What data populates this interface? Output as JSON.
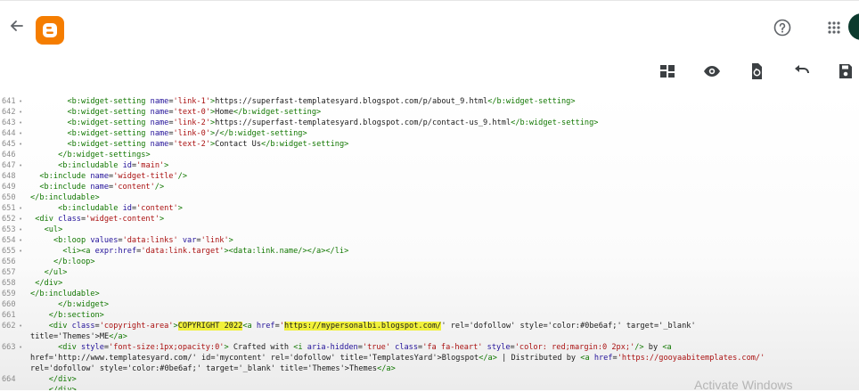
{
  "app": {
    "name": "Blogger"
  },
  "toolbar": {
    "icons": [
      "layout-icon",
      "preview-icon",
      "restore-icon",
      "undo-icon",
      "save-icon"
    ]
  },
  "editor": {
    "lines": [
      {
        "num": "641",
        "fold": "•",
        "text": "        <b:widget-setting name='link-1'>https://superfast-templatesyard.blogspot.com/p/about_9.html</b:widget-setting>"
      },
      {
        "num": "642",
        "fold": "•",
        "text": "        <b:widget-setting name='text-0'>Home</b:widget-setting>"
      },
      {
        "num": "643",
        "fold": "•",
        "text": "        <b:widget-setting name='link-2'>https://superfast-templatesyard.blogspot.com/p/contact-us_9.html</b:widget-setting>"
      },
      {
        "num": "644",
        "fold": "•",
        "text": "        <b:widget-setting name='link-0'>/</b:widget-setting>"
      },
      {
        "num": "645",
        "fold": "•",
        "text": "        <b:widget-setting name='text-2'>Contact Us</b:widget-setting>"
      },
      {
        "num": "646",
        "fold": "",
        "text": "      </b:widget-settings>"
      },
      {
        "num": "647",
        "fold": "•",
        "text": "      <b:includable id='main'>"
      },
      {
        "num": "648",
        "fold": "",
        "text": "  <b:include name='widget-title'/>"
      },
      {
        "num": "649",
        "fold": "",
        "text": "  <b:include name='content'/>"
      },
      {
        "num": "650",
        "fold": "",
        "text": "</b:includable>"
      },
      {
        "num": "651",
        "fold": "•",
        "text": "      <b:includable id='content'>"
      },
      {
        "num": "652",
        "fold": "•",
        "text": " <div class='widget-content'>"
      },
      {
        "num": "653",
        "fold": "•",
        "text": "   <ul>"
      },
      {
        "num": "654",
        "fold": "•",
        "text": "     <b:loop values='data:links' var='link'>"
      },
      {
        "num": "655",
        "fold": "•",
        "text": "       <li><a expr:href='data:link.target'><data:link.name/></a></li>"
      },
      {
        "num": "656",
        "fold": "",
        "text": "     </b:loop>"
      },
      {
        "num": "657",
        "fold": "",
        "text": "   </ul>"
      },
      {
        "num": "658",
        "fold": "",
        "text": " </div>"
      },
      {
        "num": "659",
        "fold": "",
        "text": "</b:includable>"
      },
      {
        "num": "660",
        "fold": "",
        "text": "      </b:widget>"
      },
      {
        "num": "661",
        "fold": "",
        "text": "    </b:section>"
      },
      {
        "num": "662",
        "fold": "•",
        "text": "    <div class='copyright-area'>COPYRIGHT 2022<a href='https://mypersonalbi.blogspot.com/' rel='dofollow' style='color:#0be6af;' target='_blank'"
      },
      {
        "num": "",
        "fold": "",
        "text": "title='Themes'>ME</a>"
      },
      {
        "num": "663",
        "fold": "•",
        "text": "      <div style='font-size:1px;opacity:0'> Crafted with <i aria-hidden='true' class='fa fa-heart' style='color: red;margin:0 2px;'/> by <a"
      },
      {
        "num": "",
        "fold": "",
        "text": "href='http://www.templatesyard.com/' id='mycontent' rel='dofollow' title='TemplatesYard'>Blogspot</a> | Distributed by <a href='https://gooyaabitemplates.com/'"
      },
      {
        "num": "",
        "fold": "",
        "text": "rel='dofollow' style='color:#0be6af;' target='_blank' title='Themes'>Themes</a>"
      },
      {
        "num": "664",
        "fold": "",
        "text": "    </div>"
      },
      {
        "num": "",
        "fold": "",
        "text": "    </div>"
      }
    ],
    "highlights": [
      "COPYRIGHT 2022",
      "https://mypersonalbi.blogspot.com/"
    ]
  },
  "watermark": "Activate Windows"
}
